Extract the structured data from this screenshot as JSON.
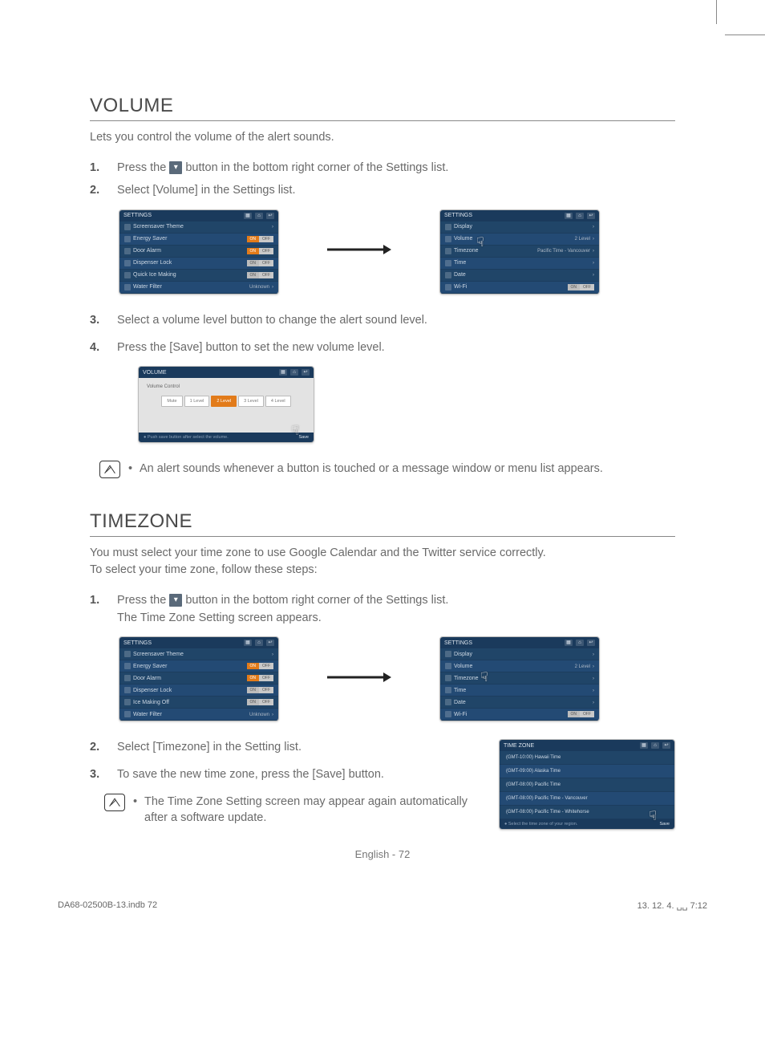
{
  "sections": {
    "volume": {
      "title": "VOLUME",
      "intro": "Lets you control the volume of the alert sounds.",
      "steps": [
        {
          "num": "1.",
          "pre": "Press the ",
          "post": " button in the bottom right corner of the Settings list."
        },
        {
          "num": "2.",
          "text": "Select [Volume] in the Settings list."
        },
        {
          "num": "3.",
          "text": "Select a volume level button to change the alert sound level."
        },
        {
          "num": "4.",
          "text": "Press the [Save] button to set the new volume level."
        }
      ],
      "note": "An alert sounds whenever a button is touched or a message window or menu list appears."
    },
    "timezone": {
      "title": "TIMEZONE",
      "intro1": "You must select your time zone to use Google Calendar and the Twitter service correctly.",
      "intro2": "To select your time zone, follow these steps:",
      "steps": [
        {
          "num": "1.",
          "pre": "Press the ",
          "post": " button in the bottom right corner of the Settings list.",
          "line2": "The Time Zone Setting screen appears."
        },
        {
          "num": "2.",
          "text": "Select [Timezone] in the Setting list."
        },
        {
          "num": "3.",
          "text": "To save the new time zone, press the [Save] button."
        }
      ],
      "note": "The Time Zone Setting screen may appear again automatically after a software update."
    }
  },
  "screens": {
    "settings_a": {
      "title": "SETTINGS",
      "rows": [
        {
          "icon": "screensaver-icon",
          "label": "Screensaver Theme",
          "right": "chev"
        },
        {
          "icon": "energy-icon",
          "label": "Energy Saver",
          "right": "toggle-on"
        },
        {
          "icon": "door-icon",
          "label": "Door Alarm",
          "right": "toggle-on"
        },
        {
          "icon": "lock-icon",
          "label": "Dispenser Lock",
          "right": "toggle-off"
        },
        {
          "icon": "ice-icon",
          "label": "Quick Ice Making",
          "right": "toggle-off-small"
        },
        {
          "icon": "filter-icon",
          "label": "Water Filter",
          "right": "unknown"
        }
      ],
      "unknown_label": "Unknown"
    },
    "settings_b": {
      "title": "SETTINGS",
      "rows": [
        {
          "icon": "display-icon",
          "label": "Display",
          "right": "chev"
        },
        {
          "icon": "volume-icon",
          "label": "Volume",
          "right_text": "2 Level",
          "right": "chev"
        },
        {
          "icon": "globe-icon",
          "label": "Timezone",
          "right_text": "Pacific Time - Vancouver",
          "right": "chev"
        },
        {
          "icon": "clock-icon",
          "label": "Time",
          "right": "chev"
        },
        {
          "icon": "date-icon",
          "label": "Date",
          "right": "chev"
        },
        {
          "icon": "wifi-icon",
          "label": "Wi-Fi",
          "right": "toggle-grey"
        }
      ]
    },
    "settings_c": {
      "title": "SETTINGS",
      "rows": [
        {
          "icon": "screensaver-icon",
          "label": "Screensaver Theme",
          "right": "chev"
        },
        {
          "icon": "energy-icon",
          "label": "Energy Saver",
          "right": "toggle-on"
        },
        {
          "icon": "door-icon",
          "label": "Door Alarm",
          "right": "toggle-on"
        },
        {
          "icon": "lock-icon",
          "label": "Dispenser Lock",
          "right": "toggle-off"
        },
        {
          "icon": "ice-icon",
          "label": "Ice Making Off",
          "right": "toggle-off"
        },
        {
          "icon": "filter-icon",
          "label": "Water Filter",
          "right": "unknown"
        }
      ]
    },
    "settings_d": {
      "title": "SETTINGS",
      "rows": [
        {
          "icon": "display-icon",
          "label": "Display",
          "right": "chev"
        },
        {
          "icon": "volume-icon",
          "label": "Volume",
          "right_text": "2 Level",
          "right": "chev"
        },
        {
          "icon": "globe-icon",
          "label": "Timezone",
          "right": "chev"
        },
        {
          "icon": "clock-icon",
          "label": "Time",
          "right": "chev"
        },
        {
          "icon": "date-icon",
          "label": "Date",
          "right": "chev"
        },
        {
          "icon": "wifi-icon",
          "label": "Wi-Fi",
          "right": "toggle-grey"
        }
      ]
    },
    "volume_panel": {
      "title": "VOLUME",
      "subtitle": "Volume Control",
      "levels": [
        "Mute",
        "1 Level",
        "2 Level",
        "3 Level",
        "4 Level"
      ],
      "active_index": 2,
      "foot": "Push save button after select the volume.",
      "save": "Save"
    },
    "timezone_panel": {
      "title": "TIME ZONE",
      "rows": [
        "(GMT-10:00) Hawaii Time",
        "(GMT-09:00) Alaska Time",
        "(GMT-08:00) Pacific Time",
        "(GMT-08:00) Pacific Time - Vancouver",
        "(GMT-08:00) Pacific Time - Whitehorse"
      ],
      "foot": "Select the time zone of your region.",
      "save": "Save"
    },
    "toggle": {
      "on": "ON",
      "off": "OFF"
    }
  },
  "footer": {
    "lang": "English - 72"
  },
  "meta": {
    "file": "DA68-02500B-13.indb   72",
    "stamp": "13. 12. 4.   ␣␣ 7:12"
  }
}
